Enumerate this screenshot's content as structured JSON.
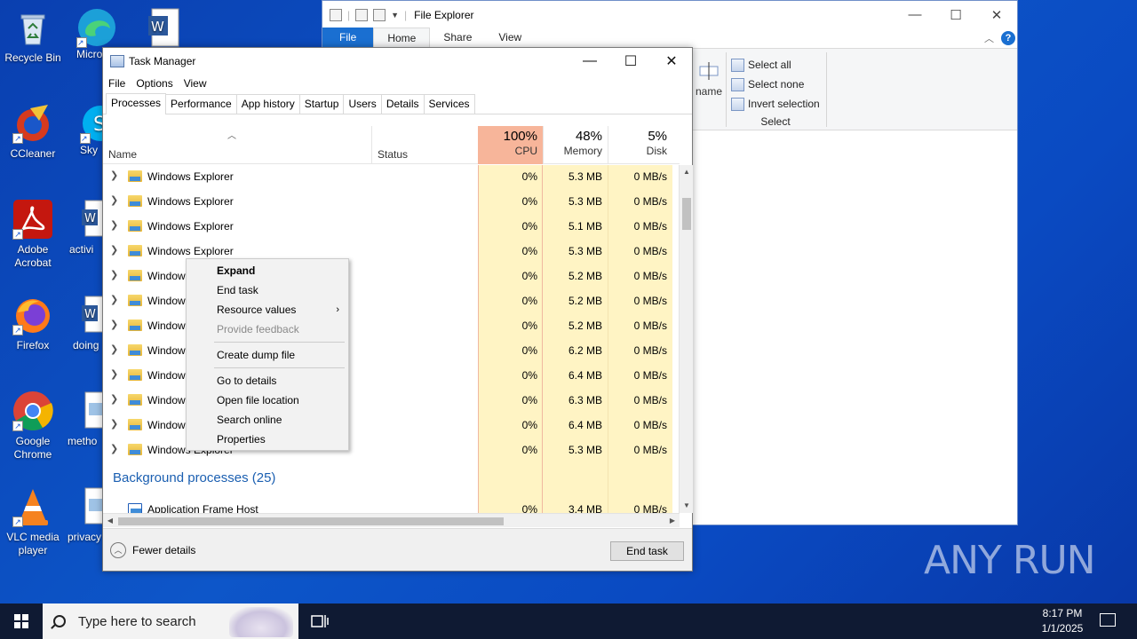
{
  "desktop": {
    "icons": [
      {
        "label": "Recycle Bin",
        "icon": "recycle-bin-icon"
      },
      {
        "label": "Micro Ed",
        "icon": "edge-icon"
      },
      {
        "label": "",
        "icon": "word-doc-icon"
      },
      {
        "label": "CCleaner",
        "icon": "ccleaner-icon"
      },
      {
        "label": "Sky",
        "icon": "skype-icon"
      },
      {
        "label": "Adobe Acrobat",
        "icon": "acrobat-icon"
      },
      {
        "label": "activi",
        "icon": "word-doc-icon"
      },
      {
        "label": "Firefox",
        "icon": "firefox-icon"
      },
      {
        "label": "doing",
        "icon": "word-doc-icon"
      },
      {
        "label": "Google Chrome",
        "icon": "chrome-icon"
      },
      {
        "label": "metho",
        "icon": "image-file-icon"
      },
      {
        "label": "VLC media player",
        "icon": "vlc-icon"
      },
      {
        "label": "privacy",
        "icon": "image-file-icon"
      }
    ],
    "watermark": "ANY RUN"
  },
  "explorer": {
    "title": "File Explorer",
    "tabs": [
      "File",
      "Home",
      "Share",
      "View"
    ],
    "rename_fragment": "name",
    "select_group": {
      "items": [
        "Select all",
        "Select none",
        "Invert selection"
      ],
      "label": "Select"
    }
  },
  "taskmgr": {
    "title": "Task Manager",
    "menu": [
      "File",
      "Options",
      "View"
    ],
    "tabs": [
      "Processes",
      "Performance",
      "App history",
      "Startup",
      "Users",
      "Details",
      "Services"
    ],
    "active_tab": "Processes",
    "columns": {
      "name": "Name",
      "status": "Status",
      "cpu": {
        "pct": "100%",
        "label": "CPU"
      },
      "memory": {
        "pct": "48%",
        "label": "Memory"
      },
      "disk": {
        "pct": "5%",
        "label": "Disk"
      }
    },
    "rows": [
      {
        "name": "Windows Explorer",
        "cpu": "0%",
        "mem": "5.3 MB",
        "disk": "0 MB/s"
      },
      {
        "name": "Windows Explorer",
        "cpu": "0%",
        "mem": "5.3 MB",
        "disk": "0 MB/s"
      },
      {
        "name": "Windows Explorer",
        "cpu": "0%",
        "mem": "5.1 MB",
        "disk": "0 MB/s"
      },
      {
        "name": "Windows Explorer",
        "cpu": "0%",
        "mem": "5.3 MB",
        "disk": "0 MB/s"
      },
      {
        "name": "Windows Explorer",
        "cpu": "0%",
        "mem": "5.2 MB",
        "disk": "0 MB/s"
      },
      {
        "name": "Windows Explorer",
        "cpu": "0%",
        "mem": "5.2 MB",
        "disk": "0 MB/s"
      },
      {
        "name": "Windows Explorer",
        "cpu": "0%",
        "mem": "5.2 MB",
        "disk": "0 MB/s"
      },
      {
        "name": "Windows Explorer",
        "cpu": "0%",
        "mem": "6.2 MB",
        "disk": "0 MB/s"
      },
      {
        "name": "Windows Explorer",
        "cpu": "0%",
        "mem": "6.4 MB",
        "disk": "0 MB/s"
      },
      {
        "name": "Windows Explorer",
        "cpu": "0%",
        "mem": "6.3 MB",
        "disk": "0 MB/s"
      },
      {
        "name": "Windows Explorer",
        "cpu": "0%",
        "mem": "6.4 MB",
        "disk": "0 MB/s"
      },
      {
        "name": "Windows Explorer",
        "cpu": "0%",
        "mem": "5.3 MB",
        "disk": "0 MB/s"
      }
    ],
    "background_header": "Background processes (25)",
    "bg_rows": [
      {
        "name": "Application Frame Host",
        "cpu": "0%",
        "mem": "3.4 MB",
        "disk": "0 MB/s"
      }
    ],
    "fewer_details": "Fewer details",
    "end_task": "End task"
  },
  "context_menu": {
    "items": [
      {
        "label": "Expand",
        "style": "bold"
      },
      {
        "label": "End task"
      },
      {
        "label": "Resource values",
        "submenu": true
      },
      {
        "label": "Provide feedback",
        "style": "disabled"
      },
      {
        "separator": true
      },
      {
        "label": "Create dump file"
      },
      {
        "separator": true
      },
      {
        "label": "Go to details"
      },
      {
        "label": "Open file location"
      },
      {
        "label": "Search online"
      },
      {
        "label": "Properties"
      }
    ]
  },
  "taskbar": {
    "search_placeholder": "Type here to search",
    "time": "8:17 PM",
    "date": "1/1/2025"
  }
}
